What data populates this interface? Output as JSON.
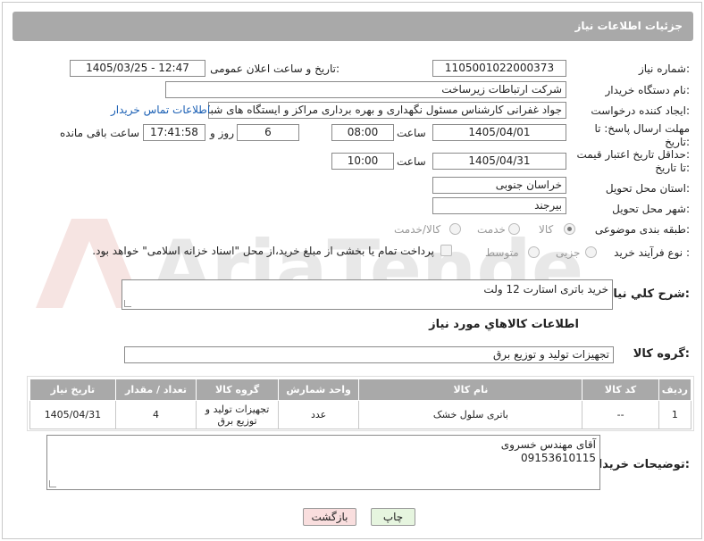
{
  "header": {
    "title": "جزئیات اطلاعات نیاز"
  },
  "fields": {
    "need_number_label": "شماره نیاز:",
    "need_number": "1105001022000373",
    "announce_label": "تاریخ و ساعت اعلان عمومی:",
    "announce_value": "1405/03/25 - 12:47",
    "buyer_org_label": "نام دستگاه خریدار:",
    "buyer_org": "شرکت ارتباطات زیرساخت",
    "creator_label": "ایجاد کننده درخواست:",
    "creator": "جواد غفرانی کارشناس مسئول نگهداری و بهره برداری مراکز و ایستگاه های شبکه",
    "contact_link": "اطلاعات تماس خریدار",
    "deadline_label_1": "مهلت ارسال پاسخ: تا",
    "deadline_label_2": "تاریخ:",
    "deadline_date": "1405/04/01",
    "time_label": "ساعت",
    "deadline_time": "08:00",
    "days_value": "6",
    "days_label": "روز و",
    "remaining_time": "17:41:58",
    "remaining_label": "ساعت باقی مانده",
    "validity_label_1": "حداقل تاریخ اعتبار قیمت:",
    "validity_label_2": "تا تاریخ:",
    "validity_date": "1405/04/31",
    "validity_time_label": "ساعت",
    "validity_time": "10:00",
    "province_label": "استان محل تحویل:",
    "province": "خراسان جنوبی",
    "city_label": "شهر محل تحویل:",
    "city": "بیرجند",
    "category_label": "طبقه بندی موضوعی:",
    "category_options": [
      "کالا",
      "خدمت",
      "کالا/خدمت"
    ],
    "process_label": "نوع فرآیند خرید :",
    "process_options": [
      "جزیی",
      "متوسط"
    ],
    "payment_note": "پرداخت تمام یا بخشی از مبلغ خرید،از محل \"اسناد خزانه اسلامی\" خواهد بود."
  },
  "description": {
    "label": "شرح کلي نياز:",
    "value": "خرید باتری استارت 12 ولت"
  },
  "goods_section": {
    "title": "اطلاعات کالاهاي مورد نياز",
    "group_label": "گروه کالا:",
    "group_value": "تجهیزات تولید و توزیع برق"
  },
  "table": {
    "headers": [
      "رديف",
      "کد کالا",
      "نام کالا",
      "واحد شمارش",
      "گروه کالا",
      "تعداد / مقدار",
      "تاريخ نياز"
    ],
    "rows": [
      [
        "1",
        "--",
        "باتری سلول خشک",
        "عدد",
        "تجهیزات تولید و توزیع برق",
        "4",
        "1405/04/31"
      ]
    ]
  },
  "buyer_notes": {
    "label": "توضیحات خریدار:",
    "line1": "آقای مهندس خسروی",
    "line2": "09153610115"
  },
  "buttons": {
    "print": "چاپ",
    "back": "بازگشت"
  },
  "watermark": {
    "text": "AriaTender.net"
  },
  "colors": {
    "header_bg": "#a9a9a9",
    "link": "#1a5fb4",
    "back_button_bg": "#f9dede",
    "print_button_bg": "#e6f5df"
  }
}
